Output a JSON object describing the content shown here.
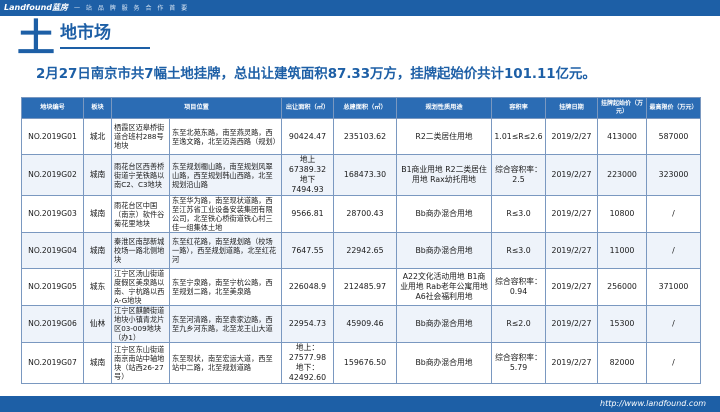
{
  "header": {
    "brand": "Landfound蓝房",
    "tagline": "一 站 品 牌 服 务 合 作 首 要"
  },
  "section": {
    "big_char": "土",
    "title": "地市场"
  },
  "headline": "2月27日南京市共7幅土地挂牌，总出让建筑面积87.33万方，挂牌起始价共计101.11亿元。",
  "table": {
    "headers": [
      "地块编号",
      "板块",
      "项目位置",
      "出让面积（㎡）",
      "总建面积（㎡）",
      "规划性质用途",
      "容积率",
      "挂牌日期",
      "挂牌起始价（万元）",
      "最高限价（万元）"
    ],
    "rows": [
      [
        "NO.2019G01",
        "城北",
        "栖霞区迈皋桥街道合班村288号地块",
        "东至北苑东路，南至燕灵路，西至逸文路，北至迈尧西路（规划）",
        "90424.47",
        "235103.62",
        "R2二类居住用地",
        "1.01≤R≤2.6",
        "2019/2/27",
        "413000",
        "587000"
      ],
      [
        "NO.2019G02",
        "城南",
        "雨花台区西善桥街道宁芜铁路以南C2、C3地块",
        "东至规划櫊山路，南至规划风翠山路，西至规划韩山西路，北至规划沿山路",
        "地上67389.32 地下7494.93",
        "168473.30",
        "B1商业用地 R2二类居住用地 Rax幼托用地",
        "综合容积率：2.5",
        "2019/2/27",
        "223000",
        "323000"
      ],
      [
        "NO.2019G03",
        "城南",
        "雨花台区中国（南京）软件谷菊花里地块",
        "东至华为路，南至现状道路，西至江苏省工业设备安装集团有限公司，北至铁心桥街道铁心村三佳一组集体土地",
        "9566.81",
        "28700.43",
        "Bb商办混合用地",
        "R≤3.0",
        "2019/2/27",
        "10800",
        "/"
      ],
      [
        "NO.2019G04",
        "城南",
        "秦淮区南部新城校场一路北侧地块",
        "东至红花路，南至规划路（校场一路），西至规划道路，北至红花河",
        "7647.55",
        "22942.65",
        "Bb商办混合用地",
        "R≤3.0",
        "2019/2/27",
        "11000",
        "/"
      ],
      [
        "NO.2019G05",
        "城东",
        "江宁区汤山街道度假区美泉路以南、宁杭路以西A-G地块",
        "东至宁泉路，南至宁杭公路，西至规划二路，北至美泉路",
        "226048.9",
        "212485.97",
        "A22文化活动用地 B1商业用地 Rab老年公寓用地 A6社会福利用地",
        "综合容积率：0.94",
        "2019/2/27",
        "256000",
        "371000"
      ],
      [
        "NO.2019G06",
        "仙林",
        "江宁区麒麟街道地块小镇青龙片区03-009地块（办1）",
        "东至河清路，南至袁家边路，西至九乡河东路，北至龙王山大道",
        "22954.73",
        "45909.46",
        "Bb商办混合用地",
        "R≤2.0",
        "2019/2/27",
        "15300",
        "/"
      ],
      [
        "NO.2019G07",
        "城南",
        "江宁区东山街道南京南站中轴地块（站西26-27号）",
        "东至现状，南至宏运大道，西至站中二路，北至规划道路",
        "地上：27577.98 地下：42492.60",
        "159676.50",
        "Bb商办混合用地",
        "综合容积率：5.79",
        "2019/2/27",
        "82000",
        "/"
      ]
    ]
  },
  "footer": {
    "url": "http://www.landfound.com"
  }
}
